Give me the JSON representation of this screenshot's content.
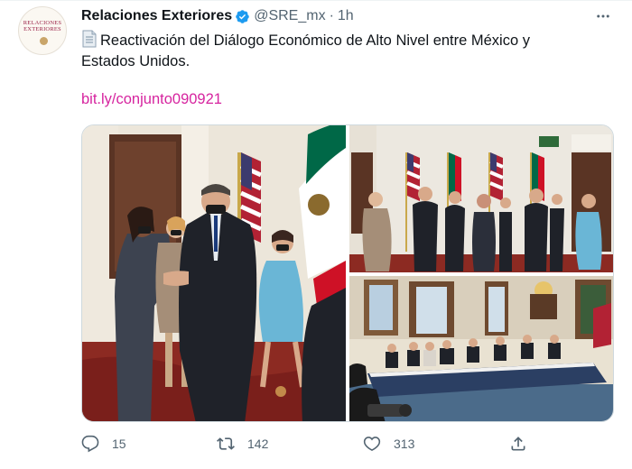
{
  "account": {
    "name": "Relaciones Exteriores",
    "handle": "@SRE_mx",
    "separator": "·",
    "time": "1h",
    "avatar_text_line1": "RELACIONES",
    "avatar_text_line2": "EXTERIORES"
  },
  "tweet": {
    "text": "Reactivación del Diálogo Económico de Alto Nivel entre México y Estados Unidos.",
    "link": "bit.ly/conjunto090921"
  },
  "media": {
    "photos": [
      "handshake-photo",
      "group-photo",
      "meeting-room-photo"
    ]
  },
  "actions": {
    "replies": "15",
    "retweets": "142",
    "likes": "313"
  },
  "icons": {
    "verified": "verified-badge-icon",
    "more": "more-options-icon",
    "document": "document-emoji-icon",
    "reply": "reply-icon",
    "retweet": "retweet-icon",
    "like": "heart-icon",
    "share": "share-icon"
  },
  "colors": {
    "verified_blue": "#1d9bf0",
    "link": "#d6249f",
    "muted": "#536471",
    "text": "#0f1419"
  }
}
